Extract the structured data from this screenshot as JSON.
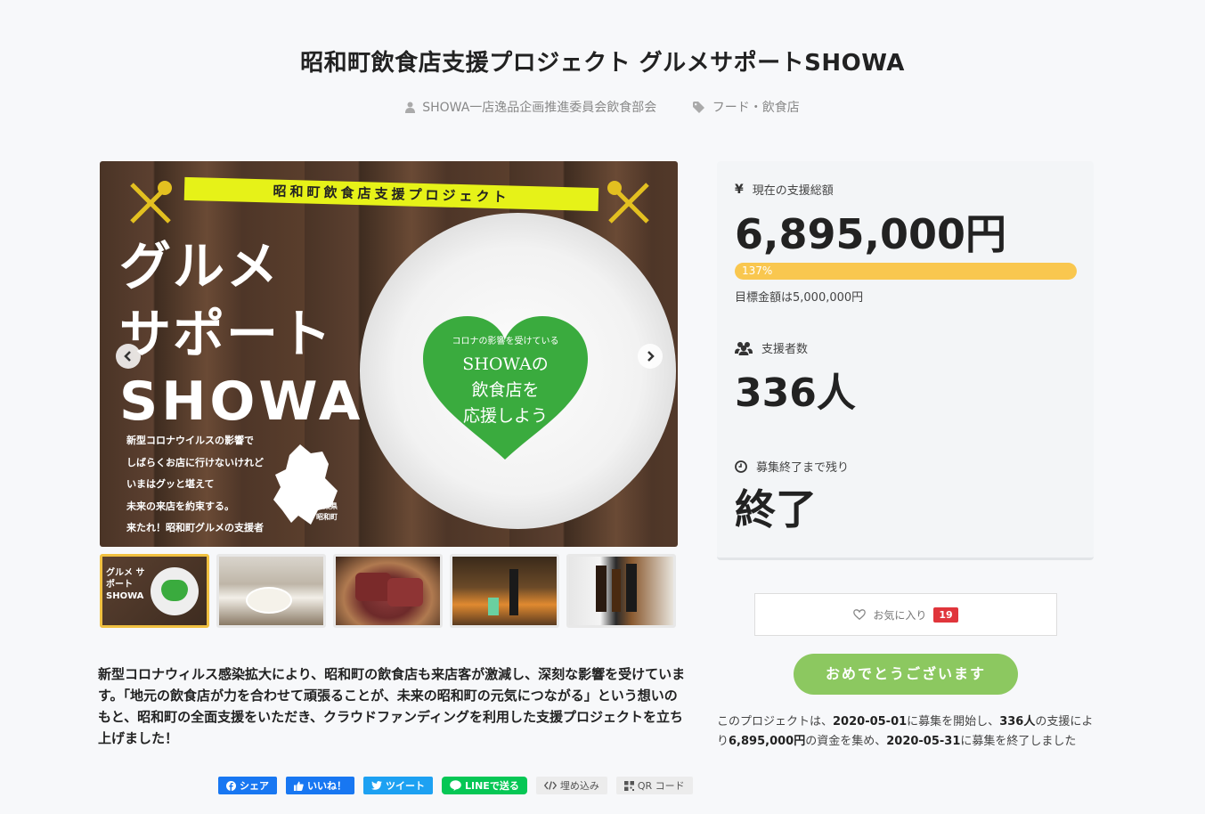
{
  "project": {
    "title": "昭和町飲食店支援プロジェクト グルメサポートSHOWA",
    "owner": "SHOWA一店逸品企画推進委員会飲食部会",
    "category": "フード・飲食店"
  },
  "hero": {
    "banner": "昭和町飲食店支援プロジェクト",
    "big_line1": "グルメ",
    "big_line2": "サポート",
    "big_line3": "SHOWA",
    "small_lines": [
      "新型コロナウイルスの影響で",
      "しばらくお店に行けないけれど",
      "いまはグッと堪えて",
      "未来の来店を約束する。",
      "来たれ！昭和町グルメの支援者"
    ],
    "heart_small": "コロナの影響を受けている",
    "heart_line1": "SHOWAの",
    "heart_line2": "飲食店を",
    "heart_line3": "応援しよう",
    "map_label": "山梨県 昭和町"
  },
  "thumbs": {
    "t1_label": "グルメ サポート SHOWA"
  },
  "description": "新型コロナウィルス感染拡大により、昭和町の飲食店も来店客が激減し、深刻な影響を受けています。「地元の飲食店が力を合わせて頑張ることが、未来の昭和町の元気につながる」という想いのもと、昭和町の全面支援をいただき、クラウドファンディングを利用した支援プロジェクトを立ち上げました！",
  "share": {
    "facebook": "シェア",
    "like": "いいね！",
    "twitter": "ツイート",
    "line": "LINEで送る",
    "embed": "埋め込み",
    "qr": "QR コード"
  },
  "stats": {
    "funded_label": "現在の支援総額",
    "funded_amount": "6,895,000円",
    "progress_percent": "137%",
    "progress_value": 137,
    "goal": "目標金額は5,000,000円",
    "backers_label": "支援者数",
    "backers": "336人",
    "remaining_label": "募集終了まで残り",
    "remaining": "終了"
  },
  "favorite": {
    "label": "お気に入り",
    "count": "19"
  },
  "cta": {
    "label": "おめでとうございます"
  },
  "summary": {
    "p1": "このプロジェクトは、",
    "start": "2020-05-01",
    "p2": "に募集を開始し、",
    "backers": "336人",
    "p3": "の支援により",
    "amount": "6,895,000円",
    "p4": "の資金を集め、",
    "end": "2020-05-31",
    "p5": "に募集を終了しました"
  },
  "colors": {
    "progress": "#f9c74f",
    "cta": "#8cc860",
    "badge": "#e0353b",
    "banner": "#e6f218",
    "heart": "#3aab3e"
  }
}
